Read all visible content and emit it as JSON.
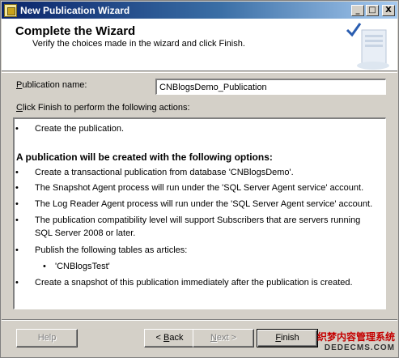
{
  "window": {
    "title": "New Publication Wizard",
    "controls": {
      "minimize": "_",
      "maximize": "□",
      "close": "X"
    }
  },
  "header": {
    "title": "Complete the Wizard",
    "subtitle": "Verify the choices made in the wizard and click Finish."
  },
  "form": {
    "publication_name_label_prefix": "",
    "publication_name_label_u": "P",
    "publication_name_label_rest": "ublication name:",
    "publication_name_value": "CNBlogsDemo_Publication",
    "actions_label_u": "C",
    "actions_label_rest": "lick Finish to perform the following actions:"
  },
  "actions": {
    "bullet": "•",
    "create": "Create the publication.",
    "heading": "A publication will be created with the following options:",
    "options": [
      "Create a transactional publication from database 'CNBlogsDemo'.",
      "The Snapshot Agent process will run under the 'SQL Server Agent service' account.",
      "The Log Reader Agent process will run under the 'SQL Server Agent service' account.",
      "The publication compatibility level will support Subscribers that are servers running SQL Server 2008 or later.",
      "Publish the following tables as articles:"
    ],
    "articles": [
      "'CNBlogsTest'"
    ],
    "snapshot": "Create a snapshot of this publication immediately after the publication is created."
  },
  "buttons": {
    "help": "Help",
    "back_prefix": "< ",
    "back_u": "B",
    "back_rest": "ack",
    "next_u": "N",
    "next_rest": "ext >",
    "finish_u": "F",
    "finish_rest": "inish"
  },
  "watermark": {
    "line1": "织梦内容管理系统",
    "line2": "DEDECMS.COM"
  },
  "colors": {
    "titlebar_start": "#0a246a",
    "titlebar_end": "#a6caf0",
    "dialog_bg": "#d4d0c8",
    "watermark": "#c40000"
  }
}
